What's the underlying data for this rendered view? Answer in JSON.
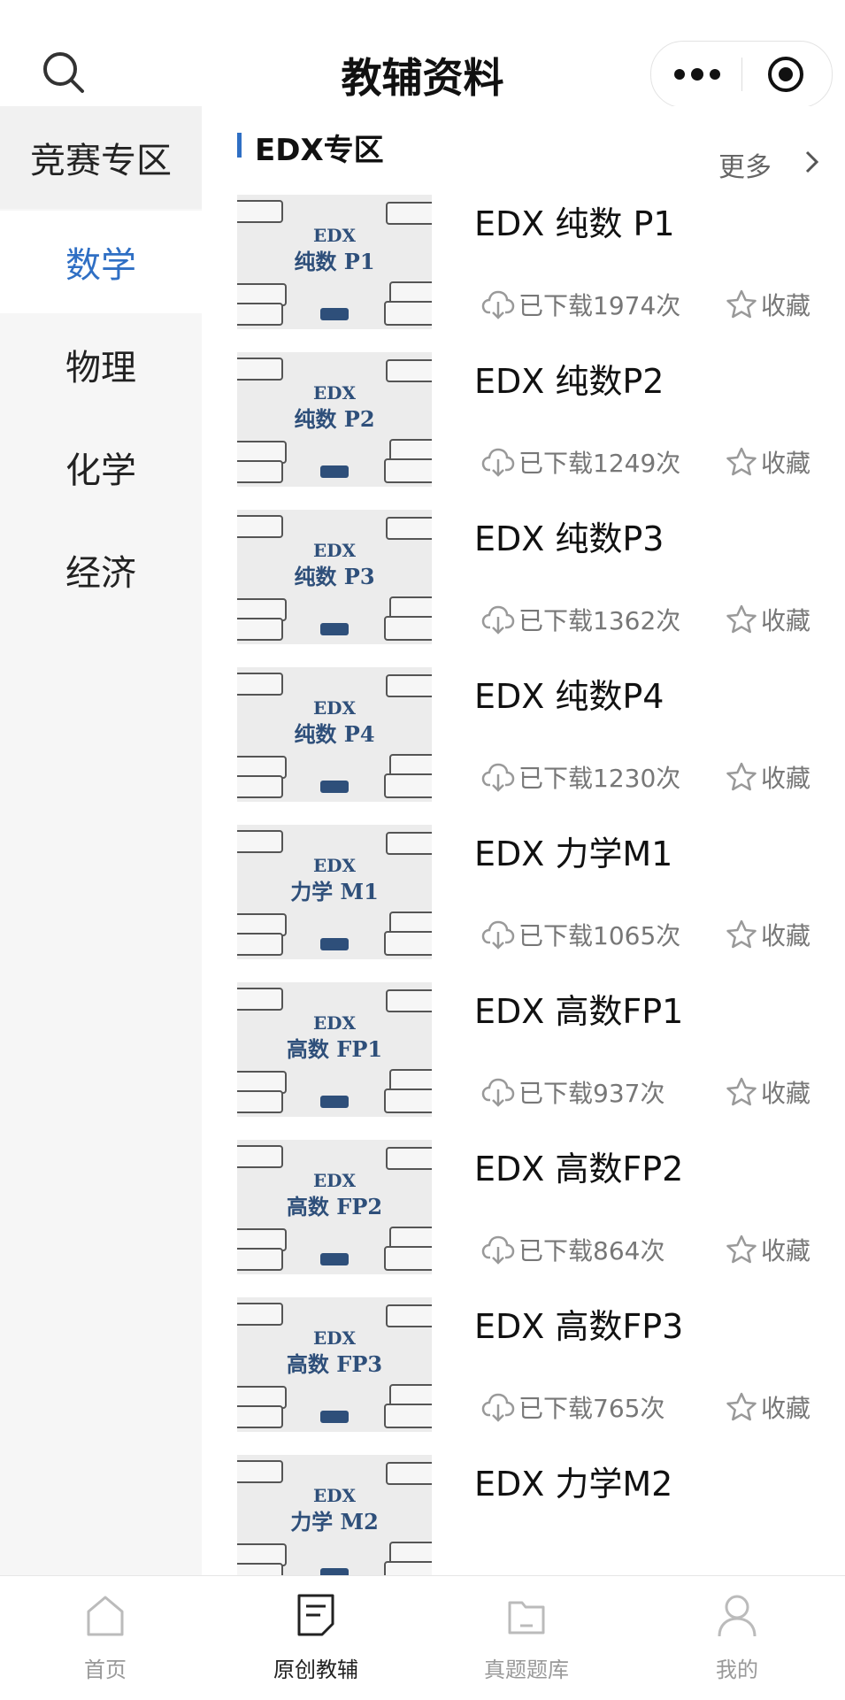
{
  "header": {
    "title": "教辅资料"
  },
  "sidebar": {
    "items": [
      {
        "label": "竞赛专区"
      },
      {
        "label": "数学"
      },
      {
        "label": "物理"
      },
      {
        "label": "化学"
      },
      {
        "label": "经济"
      }
    ],
    "active_index": 1
  },
  "section": {
    "title": "EDX专区",
    "more_label": "更多"
  },
  "items": [
    {
      "title": "EDX 纯数 P1",
      "downloads": "已下载1974次",
      "fav": "收藏",
      "thumb_line1": "EDX",
      "thumb_line2": "纯数 P1"
    },
    {
      "title": "EDX 纯数P2",
      "downloads": "已下载1249次",
      "fav": "收藏",
      "thumb_line1": "EDX",
      "thumb_line2": "纯数 P2"
    },
    {
      "title": "EDX 纯数P3",
      "downloads": "已下载1362次",
      "fav": "收藏",
      "thumb_line1": "EDX",
      "thumb_line2": "纯数 P3"
    },
    {
      "title": "EDX 纯数P4",
      "downloads": "已下载1230次",
      "fav": "收藏",
      "thumb_line1": "EDX",
      "thumb_line2": "纯数 P4"
    },
    {
      "title": "EDX 力学M1",
      "downloads": "已下载1065次",
      "fav": "收藏",
      "thumb_line1": "EDX",
      "thumb_line2": "力学 M1"
    },
    {
      "title": "EDX 高数FP1",
      "downloads": "已下载937次",
      "fav": "收藏",
      "thumb_line1": "EDX",
      "thumb_line2": "高数 FP1"
    },
    {
      "title": "EDX 高数FP2",
      "downloads": "已下载864次",
      "fav": "收藏",
      "thumb_line1": "EDX",
      "thumb_line2": "高数 FP2"
    },
    {
      "title": "EDX 高数FP3",
      "downloads": "已下载765次",
      "fav": "收藏",
      "thumb_line1": "EDX",
      "thumb_line2": "高数 FP3"
    },
    {
      "title": "EDX 力学M2",
      "downloads": "",
      "fav": "",
      "thumb_line1": "EDX",
      "thumb_line2": "力学 M2"
    }
  ],
  "tabbar": {
    "tabs": [
      {
        "label": "首页",
        "icon": "home-icon"
      },
      {
        "label": "原创教辅",
        "icon": "document-icon"
      },
      {
        "label": "真题题库",
        "icon": "folder-icon"
      },
      {
        "label": "我的",
        "icon": "user-icon"
      }
    ],
    "active_index": 1
  },
  "colors": {
    "accent": "#2f6fc4",
    "thumb_text": "#2e4f7a"
  }
}
